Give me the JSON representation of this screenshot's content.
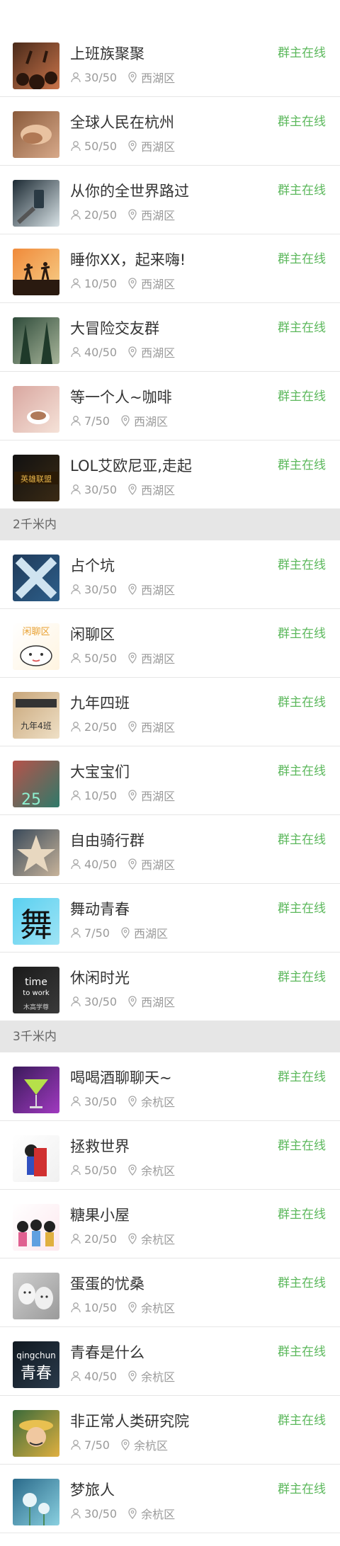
{
  "status_color": "#5cb85c",
  "groups": [
    {
      "type": "item",
      "title": "上班族聚聚",
      "count": "30/50",
      "location": "西湖区",
      "status": "群主在线",
      "thumb_bg": [
        "#4a2a1a",
        "#c9744a"
      ],
      "thumb_icon": "crowd-image"
    },
    {
      "type": "item",
      "title": "全球人民在杭州",
      "count": "50/50",
      "location": "西湖区",
      "status": "群主在线",
      "thumb_bg": [
        "#8a5a3a",
        "#d7a98a"
      ],
      "thumb_icon": "hands-image"
    },
    {
      "type": "item",
      "title": "从你的全世界路过",
      "count": "20/50",
      "location": "西湖区",
      "status": "群主在线",
      "thumb_bg": [
        "#1c2a33",
        "#d8e2e6"
      ],
      "thumb_icon": "phone-image"
    },
    {
      "type": "item",
      "title": "睡你XX，起来嗨!",
      "count": "10/50",
      "location": "西湖区",
      "status": "群主在线",
      "thumb_bg": [
        "#f08a3a",
        "#f7d08a"
      ],
      "thumb_icon": "jump-image"
    },
    {
      "type": "item",
      "title": "大冒险交友群",
      "count": "40/50",
      "location": "西湖区",
      "status": "群主在线",
      "thumb_bg": [
        "#2e4b3a",
        "#a8b59a"
      ],
      "thumb_icon": "forest-image"
    },
    {
      "type": "item",
      "title": "等一个人~咖啡",
      "count": "7/50",
      "location": "西湖区",
      "status": "群主在线",
      "thumb_bg": [
        "#d9a7a0",
        "#f5e2d8"
      ],
      "thumb_icon": "coffee-image"
    },
    {
      "type": "item",
      "title": "LOL艾欧尼亚,走起",
      "count": "30/50",
      "location": "西湖区",
      "status": "群主在线",
      "thumb_bg": [
        "#111111",
        "#3a2a14"
      ],
      "thumb_icon": "lol-logo-image"
    },
    {
      "type": "section",
      "label": "2千米内"
    },
    {
      "type": "item",
      "title": "占个坑",
      "count": "30/50",
      "location": "西湖区",
      "status": "群主在线",
      "thumb_bg": [
        "#1f3a5a",
        "#2d5f8a"
      ],
      "thumb_icon": "x-mark-image"
    },
    {
      "type": "item",
      "title": "闲聊区",
      "count": "50/50",
      "location": "西湖区",
      "status": "群主在线",
      "thumb_bg": [
        "#ffffff",
        "#fff4e0"
      ],
      "thumb_icon": "cartoon-face-image"
    },
    {
      "type": "item",
      "title": "九年四班",
      "count": "20/50",
      "location": "西湖区",
      "status": "群主在线",
      "thumb_bg": [
        "#c8a67a",
        "#efe0c6"
      ],
      "thumb_icon": "clapperboard-image"
    },
    {
      "type": "item",
      "title": "大宝宝们",
      "count": "10/50",
      "location": "西湖区",
      "status": "群主在线",
      "thumb_bg": [
        "#b5524a",
        "#2f7a6a"
      ],
      "thumb_icon": "number-25-image"
    },
    {
      "type": "item",
      "title": "自由骑行群",
      "count": "40/50",
      "location": "西湖区",
      "status": "群主在线",
      "thumb_bg": [
        "#3a4a5a",
        "#c7b39a"
      ],
      "thumb_icon": "star-hands-image"
    },
    {
      "type": "item",
      "title": "舞动青春",
      "count": "7/50",
      "location": "西湖区",
      "status": "群主在线",
      "thumb_bg": [
        "#5ad0f0",
        "#9fe4f5"
      ],
      "thumb_icon": "dance-character-image"
    },
    {
      "type": "item",
      "title": "休闲时光",
      "count": "30/50",
      "location": "西湖区",
      "status": "群主在线",
      "thumb_bg": [
        "#1a1a1a",
        "#3a3a3a"
      ],
      "thumb_icon": "time-to-work-image"
    },
    {
      "type": "section",
      "label": "3千米内"
    },
    {
      "type": "item",
      "title": "喝喝酒聊聊天~",
      "count": "30/50",
      "location": "余杭区",
      "status": "群主在线",
      "thumb_bg": [
        "#3a1a5a",
        "#a03ac0"
      ],
      "thumb_icon": "cocktail-image"
    },
    {
      "type": "item",
      "title": "拯救世界",
      "count": "50/50",
      "location": "余杭区",
      "status": "群主在线",
      "thumb_bg": [
        "#ffffff",
        "#f0f0f0"
      ],
      "thumb_icon": "superhero-image"
    },
    {
      "type": "item",
      "title": "糖果小屋",
      "count": "20/50",
      "location": "余杭区",
      "status": "群主在线",
      "thumb_bg": [
        "#ffffff",
        "#fde8ee"
      ],
      "thumb_icon": "girls-cartoon-image"
    },
    {
      "type": "item",
      "title": "蛋蛋的忧桑",
      "count": "10/50",
      "location": "余杭区",
      "status": "群主在线",
      "thumb_bg": [
        "#cfcfcf",
        "#9a9a9a"
      ],
      "thumb_icon": "eggs-image"
    },
    {
      "type": "item",
      "title": "青春是什么",
      "count": "40/50",
      "location": "余杭区",
      "status": "群主在线",
      "thumb_bg": [
        "#101820",
        "#2a3a4a"
      ],
      "thumb_icon": "qingchun-text-image"
    },
    {
      "type": "item",
      "title": "非正常人类研究院",
      "count": "7/50",
      "location": "余杭区",
      "status": "群主在线",
      "thumb_bg": [
        "#3a6a3a",
        "#e0b040"
      ],
      "thumb_icon": "luffy-image"
    },
    {
      "type": "item",
      "title": "梦旅人",
      "count": "30/50",
      "location": "余杭区",
      "status": "群主在线",
      "thumb_bg": [
        "#2a6a8a",
        "#8ad0e0"
      ],
      "thumb_icon": "dandelion-image"
    }
  ],
  "overlay_text": {
    "lol": "英雄联盟",
    "class_note": "九年4班",
    "num25": "25",
    "dance": "舞",
    "time_to_work": "time to work",
    "mugao": "木高学尊",
    "qingchun_en": "qingchun",
    "qingchun_cn": "青春",
    "chat_zone": "闲聊区"
  }
}
